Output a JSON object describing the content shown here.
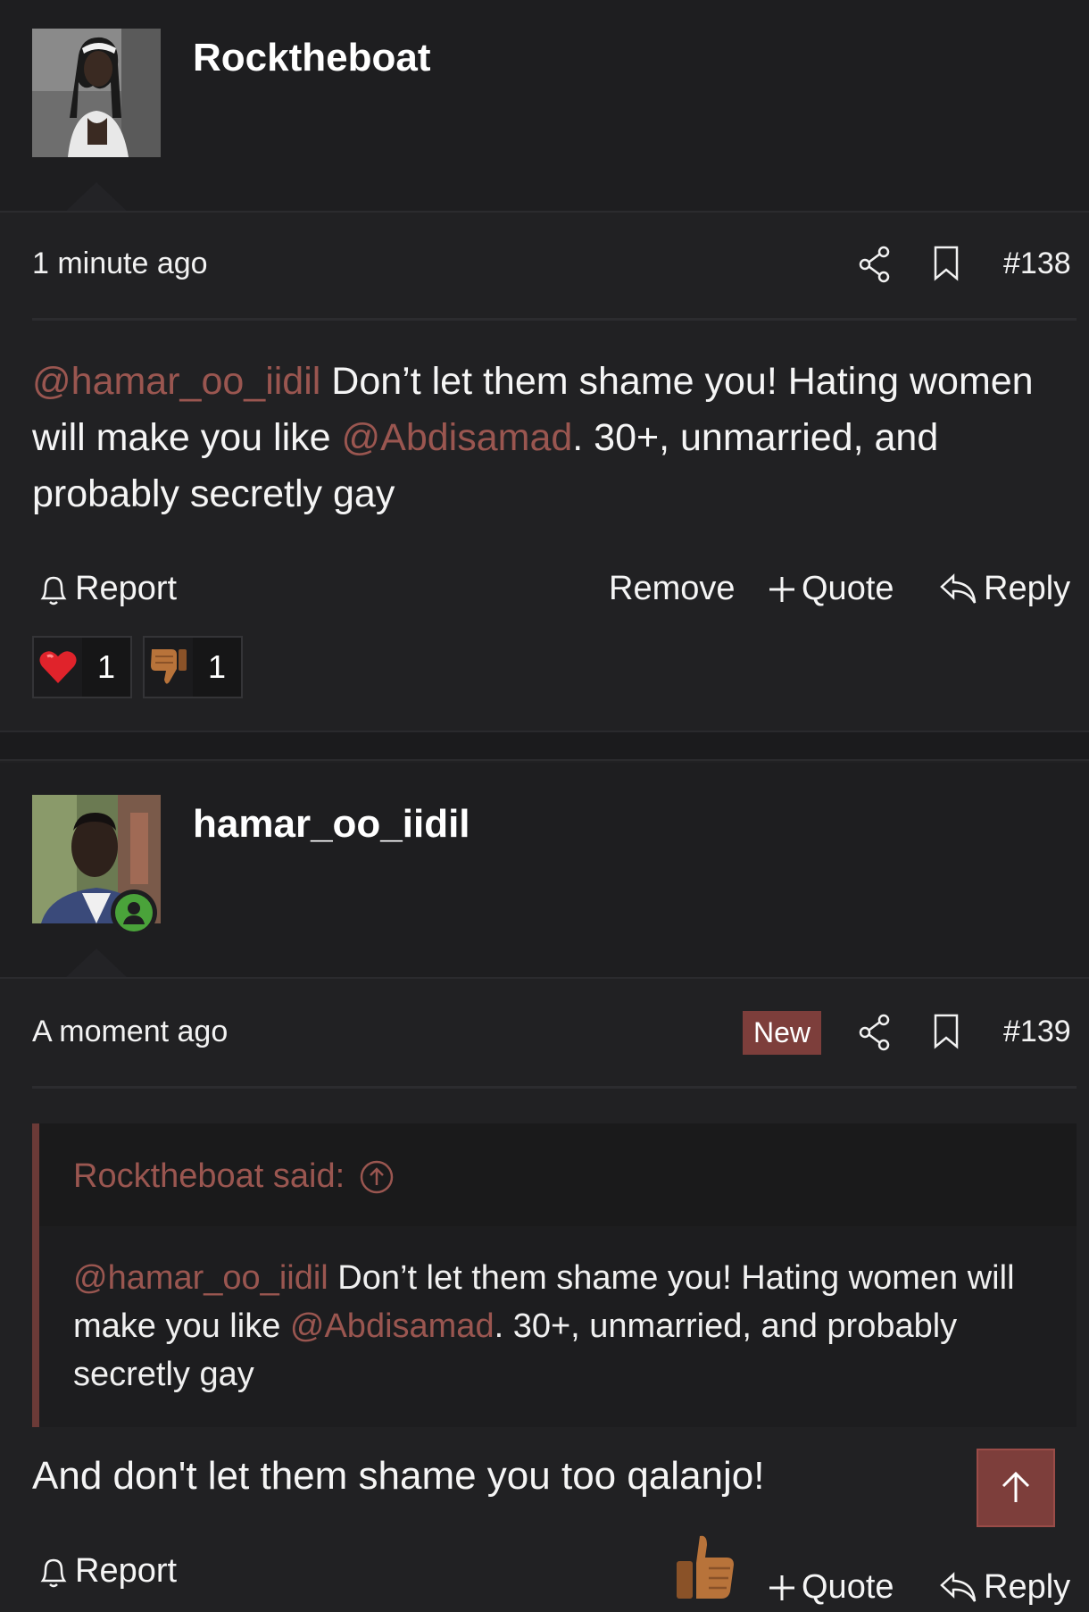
{
  "posts": [
    {
      "username": "Rocktheboat",
      "time": "1 minute ago",
      "post_number": "#138",
      "body": {
        "mention1": "@hamar_oo_iidil",
        "text1": " Don’t let them shame you! Hating women will make you like ",
        "mention2": "@Abdisamad",
        "text2": ". 30+, unmarried, and probably secretly gay"
      },
      "actions": {
        "report": "Report",
        "remove": "Remove",
        "quote": "Quote",
        "reply": "Reply"
      },
      "reactions": [
        {
          "icon": "heart",
          "count": "1"
        },
        {
          "icon": "thumbs-down",
          "count": "1"
        }
      ]
    },
    {
      "username": "hamar_oo_iidil",
      "time": "A moment ago",
      "badge": "New",
      "post_number": "#139",
      "quote": {
        "attribution": "Rocktheboat said:",
        "mention1": "@hamar_oo_iidil",
        "text1": " Don’t let them shame you! Hating women will make you like ",
        "mention2": "@Abdisamad",
        "text2": ". 30+, unmarried, and probably secretly gay"
      },
      "body": "And don't let them shame you too qalanjo!",
      "actions": {
        "report": "Report",
        "quote": "Quote",
        "reply": "Reply"
      }
    }
  ],
  "colors": {
    "background": "#212123",
    "accent": "#7d3e3b",
    "mention": "#9a5650",
    "online": "#4aa33a"
  }
}
